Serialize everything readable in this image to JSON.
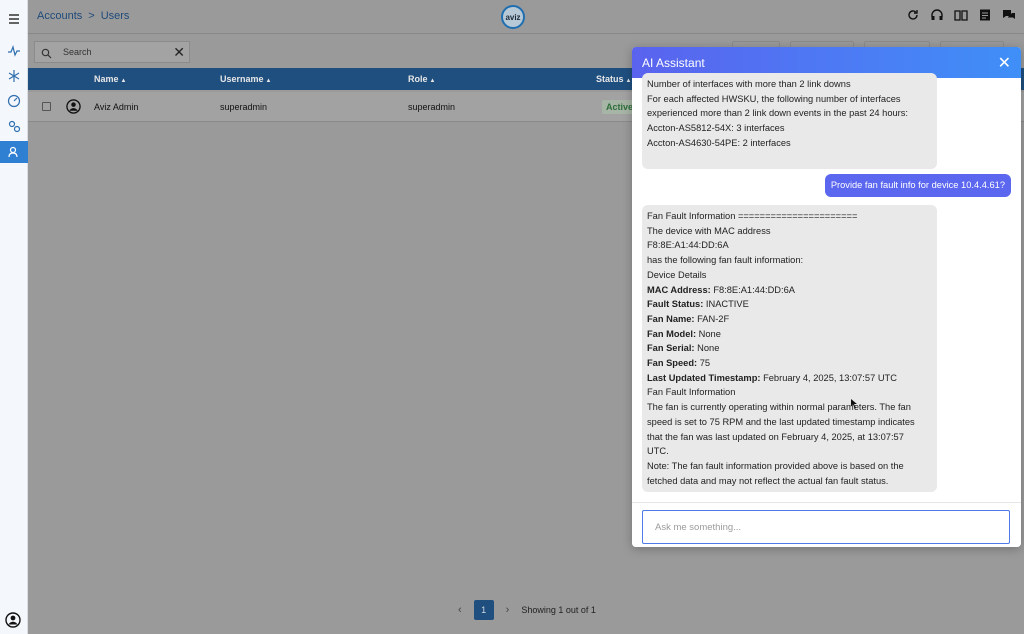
{
  "breadcrumb": {
    "root": "Accounts",
    "separator": ">",
    "current": "Users"
  },
  "logo_text": "aviz",
  "search": {
    "placeholder": "Search"
  },
  "table": {
    "columns": [
      "Name",
      "Username",
      "Role",
      "Status"
    ],
    "rows": [
      {
        "name": "Aviz Admin",
        "username": "superadmin",
        "role": "superadmin",
        "status": "Active"
      }
    ]
  },
  "pagination": {
    "current_page": "1",
    "summary": "Showing 1 out of 1"
  },
  "ai_assistant": {
    "title": "AI Assistant",
    "close_glyph": "✕",
    "previous_bot_lines": [
      "Number of interfaces with more than 2 link downs",
      "For each affected HWSKU, the following number of interfaces",
      "experienced more than 2 link down events in the past 24 hours:",
      "Accton-AS5812-54X: 3 interfaces",
      "Accton-AS4630-54PE: 2 interfaces"
    ],
    "user_message": "Provide fan fault info for device 10.4.4.61?",
    "reply": {
      "header": "Fan Fault Information ======================",
      "intro1": "The device with MAC address",
      "mac_plain": "F8:8E:A1:44:DD:6A",
      "intro2": "has the following fan fault information:",
      "details_heading": "Device Details",
      "fields": [
        {
          "label": "MAC Address:",
          "value": "F8:8E:A1:44:DD:6A"
        },
        {
          "label": "Fault Status:",
          "value": "INACTIVE"
        },
        {
          "label": "Fan Name:",
          "value": "FAN-2F"
        },
        {
          "label": "Fan Model:",
          "value": "None"
        },
        {
          "label": "Fan Serial:",
          "value": "None"
        },
        {
          "label": "Fan Speed:",
          "value": "75"
        },
        {
          "label": "Last Updated Timestamp:",
          "value": "February 4, 2025, 13:07:57 UTC"
        }
      ],
      "section2_heading": "Fan Fault Information",
      "summary_lines": [
        "The fan is currently operating within normal parameters. The fan",
        "speed is set to 75 RPM and the last updated timestamp indicates",
        "that the fan was last updated on February 4, 2025, at 13:07:57",
        "UTC."
      ],
      "note_lines": [
        "Note: The fan fault information provided above is based on the",
        "fetched data and may not reflect the actual fan fault status."
      ]
    },
    "input_placeholder": "Ask me something..."
  },
  "colors": {
    "header_gradient_start": "#5a63ee",
    "header_gradient_end": "#3f8ff7",
    "user_bubble": "#5b67ef",
    "bot_bubble": "#e9e9ea",
    "table_header": "#1f4f7f",
    "active_sidebar": "#2f7fd2"
  }
}
